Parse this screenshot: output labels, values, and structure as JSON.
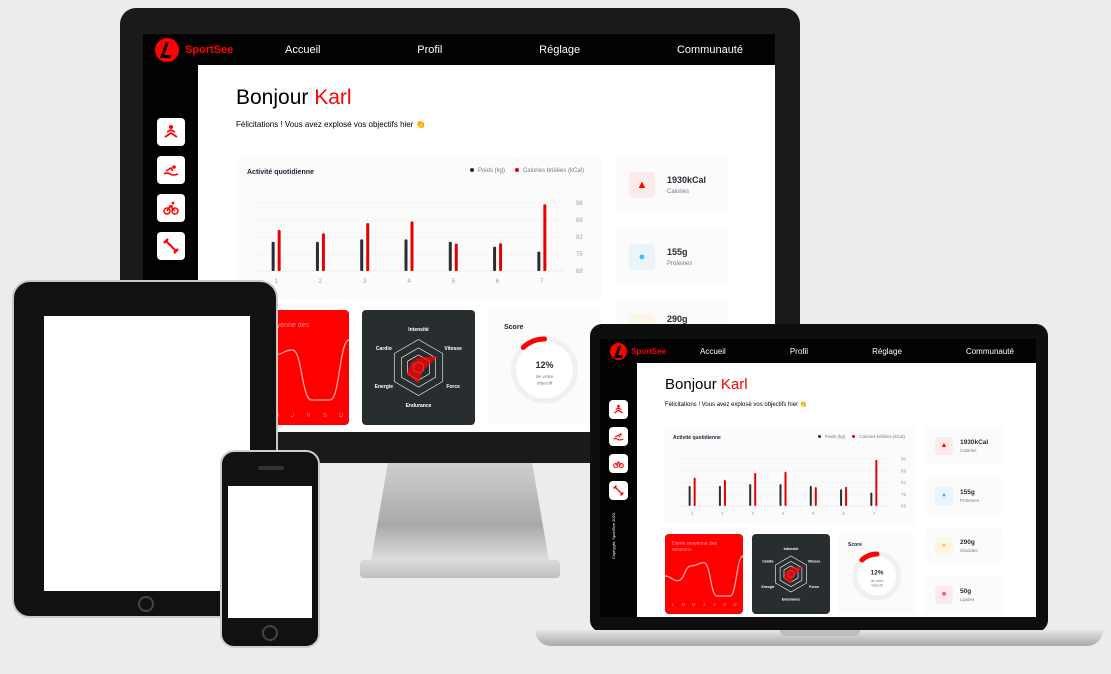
{
  "app": {
    "brand": "SportSee",
    "nav": [
      "Accueil",
      "Profil",
      "Réglage",
      "Communauté"
    ],
    "sidebar_icons": [
      "yoga-icon",
      "swim-icon",
      "bike-icon",
      "dumbbell-icon"
    ],
    "copyright": "Copiryght, SportSee 2020",
    "greeting_prefix": "Bonjour ",
    "user_name": "Karl",
    "congrats": "Félicitations ! Vous avez explosé vos objectifs hier 👏",
    "activity": {
      "title": "Activité quotidienne",
      "legend_weight": "Poids (kg)",
      "legend_calories": "Calories brûlées (kCal)",
      "y_ticks": [
        "96",
        "89",
        "82",
        "75",
        "68"
      ]
    },
    "kpis": [
      {
        "value": "1930kCal",
        "label": "Calories",
        "icon": "flame-icon",
        "bg": "#fbeaea",
        "color": "#ff0000"
      },
      {
        "value": "155g",
        "label": "Proteines",
        "icon": "drumstick-icon",
        "bg": "#e9f4fb",
        "color": "#4ab8ff"
      },
      {
        "value": "290g",
        "label": "Glucides",
        "icon": "apple-icon",
        "bg": "#fbf6e5",
        "color": "#fdcc0c"
      },
      {
        "value": "50g",
        "label": "Lipides",
        "icon": "burger-icon",
        "bg": "#fbeaef",
        "color": "#fd5181"
      }
    ],
    "average": {
      "title": "Durée moyenne des sessions",
      "days": [
        "L",
        "M",
        "M",
        "J",
        "V",
        "S",
        "D"
      ]
    },
    "radar": {
      "labels": [
        "Intensité",
        "Vitesse",
        "Force",
        "Endurance",
        "Energie",
        "Cardio"
      ]
    },
    "score": {
      "title": "Score",
      "value_text": "12%",
      "caption_line1": "de votre",
      "caption_line2": "objectif",
      "fraction": 0.12
    },
    "colors": {
      "accent": "#ff0101",
      "dark": "#020203",
      "weight": "#282d30",
      "calories": "#e60000"
    }
  },
  "chart_data": [
    {
      "type": "bar",
      "title": "Activité quotidienne",
      "categories": [
        "1",
        "2",
        "3",
        "4",
        "5",
        "6",
        "7"
      ],
      "series": [
        {
          "name": "Poids (kg)",
          "values": [
            80,
            80,
            81,
            81,
            80,
            78,
            76
          ]
        },
        {
          "name": "Calories brûlées (kCal)",
          "values": [
            240,
            220,
            280,
            290,
            160,
            162,
            390
          ]
        }
      ],
      "ylim": [
        68,
        96
      ],
      "y_ticks": [
        68,
        75,
        82,
        89,
        96
      ],
      "legend": "top-right"
    },
    {
      "type": "line",
      "title": "Durée moyenne des sessions",
      "categories": [
        "L",
        "M",
        "M",
        "J",
        "V",
        "S",
        "D"
      ],
      "values": [
        30,
        23,
        45,
        50,
        0,
        0,
        60
      ]
    },
    {
      "type": "radar",
      "categories": [
        "Intensité",
        "Vitesse",
        "Force",
        "Endurance",
        "Energie",
        "Cardio"
      ],
      "values": [
        90,
        200,
        50,
        140,
        120,
        80
      ]
    },
    {
      "type": "pie",
      "title": "Score",
      "values": [
        0.12
      ]
    }
  ]
}
